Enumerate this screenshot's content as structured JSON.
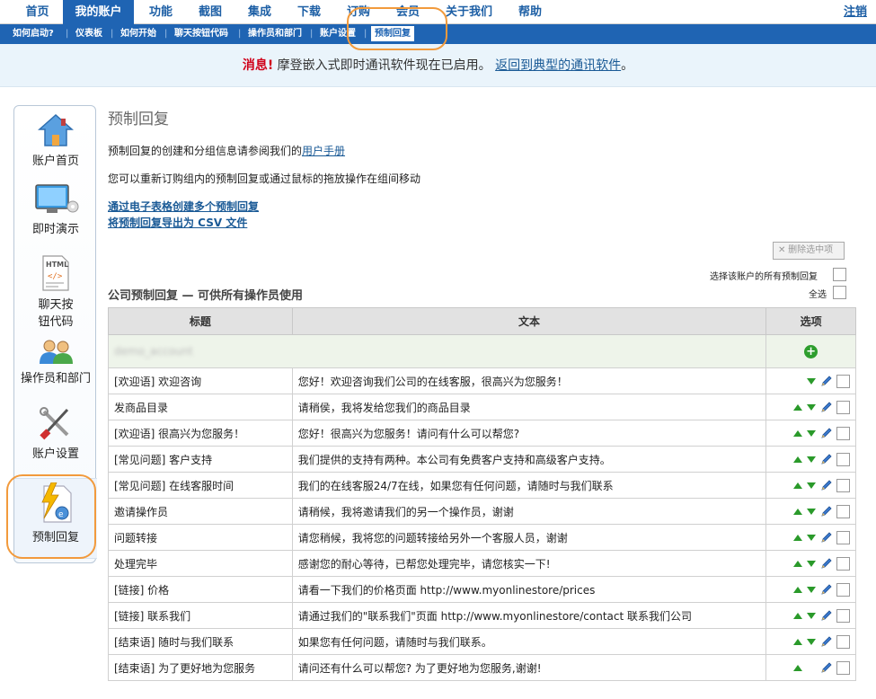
{
  "topnav": {
    "items": [
      "首页",
      "我的账户",
      "功能",
      "截图",
      "集成",
      "下载",
      "订购",
      "会员",
      "关于我们",
      "帮助"
    ],
    "logout": "注销"
  },
  "subnav": {
    "items": [
      "如何启动?",
      "仪表板",
      "如何开始",
      "聊天按钮代码",
      "操作员和部门",
      "账户设置",
      "预制回复"
    ]
  },
  "notice": {
    "label": "消息!",
    "text": " 摩登嵌入式即时通讯软件现在已启用。",
    "link": "返回到典型的通讯软件",
    "end": "。"
  },
  "sidebar": {
    "items": [
      "账户首页",
      "即时演示",
      "聊天按钮代码",
      "操作员和部门",
      "账户设置",
      "预制回复"
    ],
    "chat_line1": "聊天按",
    "chat_line2": "钮代码",
    "html_badge": "HTML"
  },
  "page": {
    "title": "预制回复",
    "intro": "预制回复的创建和分组信息请参阅我们的",
    "manual_link": "用户手册",
    "drag_info": "您可以重新订购组内的预制回复或通过鼠标的拖放操作在组间移动",
    "spreadsheet_link": "通过电子表格创建多个预制回复",
    "export_link": "将预制回复导出为 CSV 文件",
    "delete_selected": "删除选中项",
    "select_account_all": "选择该账户的所有预制回复",
    "select_all": "全选",
    "section_title": "公司预制回复 — 可供所有操作员使用"
  },
  "table": {
    "headers": [
      "标题",
      "文本",
      "选项"
    ],
    "group": "demo_account",
    "rows": [
      {
        "title": "[欢迎语] 欢迎咨询",
        "text": "您好！欢迎咨询我们公司的在线客服，很高兴为您服务！"
      },
      {
        "title": "发商品目录",
        "text": "请稍侯，我将发给您我们的商品目录"
      },
      {
        "title": "[欢迎语] 很高兴为您服务！",
        "text": "您好！很高兴为您服务！请问有什么可以帮您?"
      },
      {
        "title": "[常见问题] 客户支持",
        "text": "我们提供的支持有两种。本公司有免费客户支持和高级客户支持。"
      },
      {
        "title": "[常见问题] 在线客服时间",
        "text": "我们的在线客服24/7在线，如果您有任何问题，请随时与我们联系"
      },
      {
        "title": "邀请操作员",
        "text": "请稍候，我将邀请我们的另一个操作员，谢谢"
      },
      {
        "title": "问题转接",
        "text": "请您稍候，我将您的问题转接给另外一个客服人员，谢谢"
      },
      {
        "title": "处理完毕",
        "text": "感谢您的耐心等待，已帮您处理完毕，请您核实一下!"
      },
      {
        "title": "[链接] 价格",
        "text": "请看一下我们的价格页面 http://www.myonlinestore/prices"
      },
      {
        "title": "[链接] 联系我们",
        "text": "请通过我们的\"联系我们\"页面 http://www.myonlinestore/contact 联系我们公司"
      },
      {
        "title": "[结束语] 随时与我们联系",
        "text": "如果您有任何问题，请随时与我们联系。"
      },
      {
        "title": "[结束语] 为了更好地为您服务",
        "text": "请问还有什么可以帮您? 为了更好地为您服务,谢谢!"
      }
    ]
  },
  "colors": {
    "brand": "#1f64b3",
    "highlight": "#f29a3c",
    "alert": "#d0021b",
    "group_bg": "#eef4ea"
  },
  "icons": [
    "house-icon",
    "monitor-icon",
    "html-file-icon",
    "users-icon",
    "tools-icon",
    "quick-reply-icon",
    "arrow-up-icon",
    "arrow-down-icon",
    "pencil-icon",
    "plus-icon",
    "close-icon"
  ]
}
